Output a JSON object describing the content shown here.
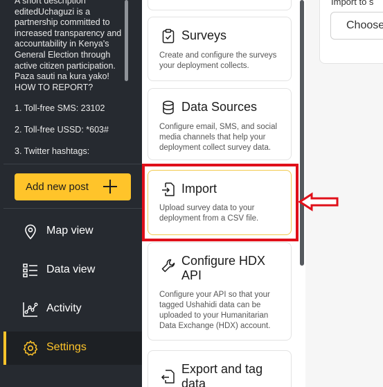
{
  "sidebar": {
    "description_lines": [
      "A short description editedUchaguzi is a partnership committed to increased transparency and accountability in Kenya's General Election through active citizen participation. Paza sauti na kura yako! HOW TO REPORT?",
      "1. Toll-free SMS: 23102",
      "2. Toll-free USSD: *603#",
      "3. Twitter hashtags:"
    ],
    "add_post_label": "Add new post",
    "nav": [
      {
        "label": "Map view",
        "icon": "map-pin-icon"
      },
      {
        "label": "Data view",
        "icon": "data-list-icon"
      },
      {
        "label": "Activity",
        "icon": "activity-chart-icon"
      },
      {
        "label": "Settings",
        "icon": "gear-icon",
        "active": true
      }
    ]
  },
  "settings_cards": [
    {
      "title": "Surveys",
      "description": "Create and configure the surveys your deployment collects.",
      "icon": "clipboard-icon"
    },
    {
      "title": "Data Sources",
      "description": "Configure email, SMS, and social media channels that help your deployment collect survey data.",
      "icon": "database-icon"
    },
    {
      "title": "Import",
      "description": "Upload survey data to your deployment from a CSV file.",
      "icon": "file-import-icon",
      "highlighted": true
    },
    {
      "title": "Configure HDX API",
      "description": "Configure your API so that your tagged Ushahidi data can be uploaded to your Humanitarian Data Exchange (HDX) account.",
      "icon": "wrench-icon"
    },
    {
      "title": "Export and tag data",
      "description": "",
      "icon": "file-export-icon"
    }
  ],
  "right_panel": {
    "label": "Import to s",
    "choose_button": "Choose"
  },
  "colors": {
    "sidebar_bg": "#262a30",
    "accent": "#ffc42a",
    "annotation_red": "#e0101a"
  }
}
